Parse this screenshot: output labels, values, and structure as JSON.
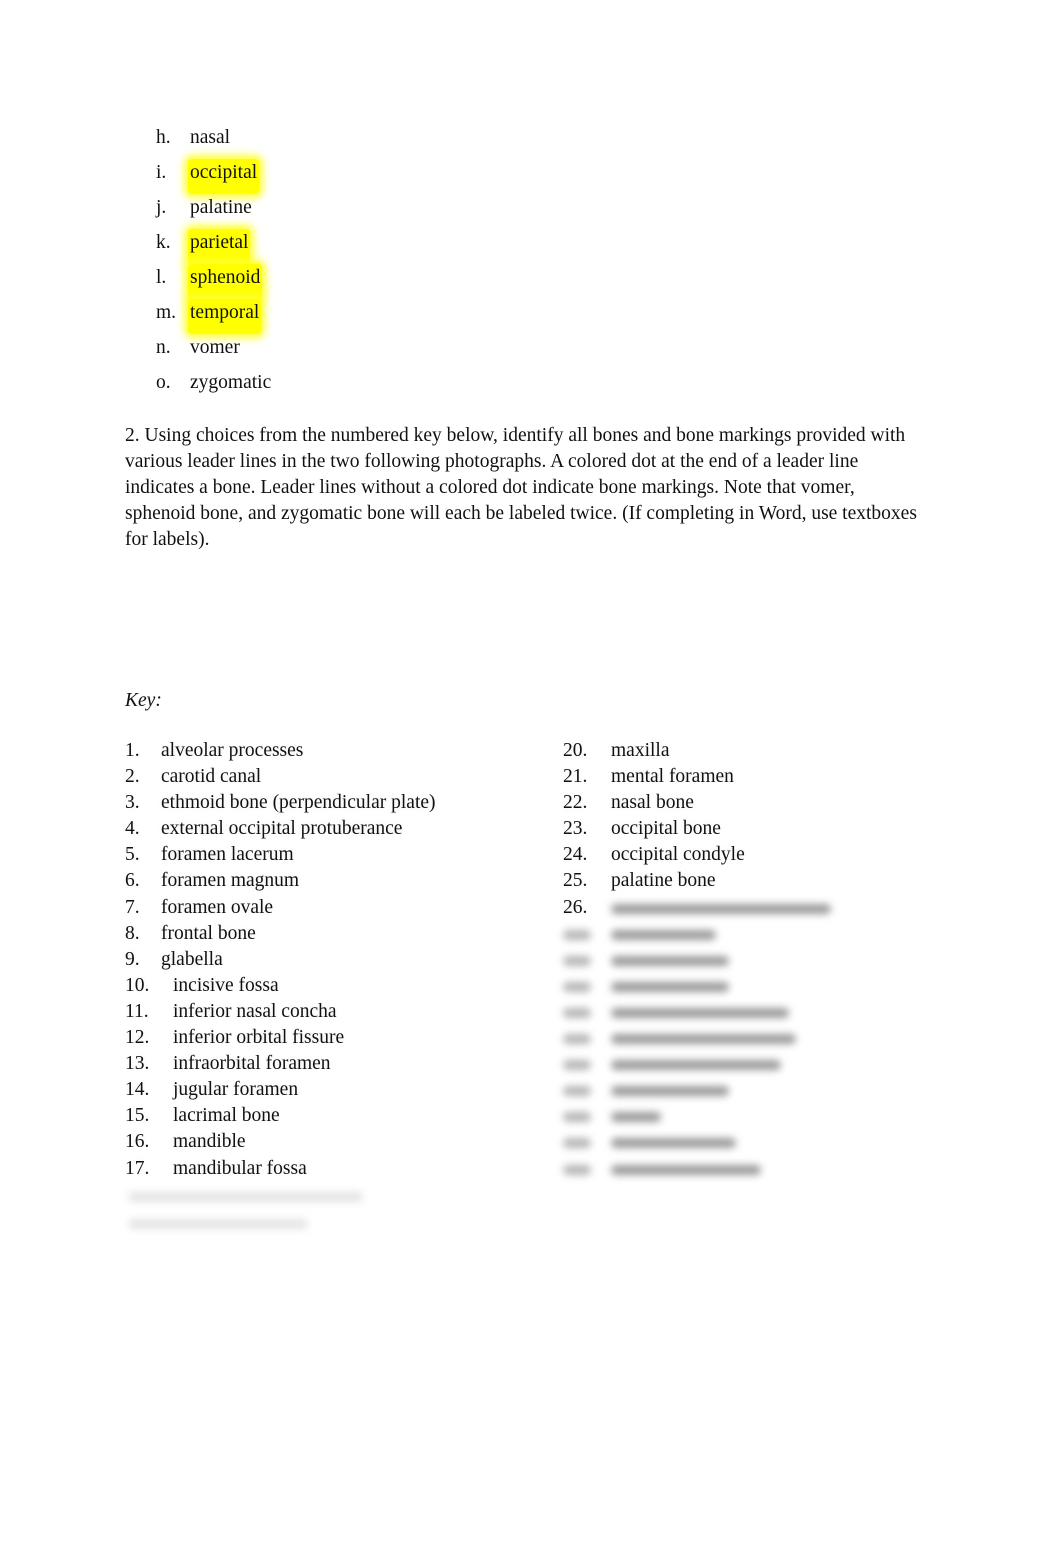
{
  "lettered_list": [
    {
      "marker": "h.",
      "text": "nasal",
      "highlighted": false
    },
    {
      "marker": "i.",
      "text": "occipital",
      "highlighted": true
    },
    {
      "marker": "j.",
      "text": "palatine",
      "highlighted": false
    },
    {
      "marker": "k.",
      "text": "parietal",
      "highlighted": true
    },
    {
      "marker": "l.",
      "text": "sphenoid",
      "highlighted": true
    },
    {
      "marker": "m.",
      "text": "temporal",
      "highlighted": true
    },
    {
      "marker": "n.",
      "text": "vomer",
      "highlighted": false
    },
    {
      "marker": "o.",
      "text": "zygomatic",
      "highlighted": false
    }
  ],
  "highlight_color": "#ffff00",
  "instructions": "2. Using choices from the numbered key below, identify all bones and bone markings provided with various leader lines in the two following photographs. A colored dot at the end of a leader line indicates a bone. Leader lines without a colored dot indicate bone markings. Note that vomer, sphenoid bone, and zygomatic bone will each be labeled twice. (If completing in Word, use textboxes for labels).",
  "key_label": "Key:",
  "key_left": [
    {
      "num": "1.",
      "text": "alveolar processes"
    },
    {
      "num": "2.",
      "text": "carotid canal"
    },
    {
      "num": "3.",
      "text": "ethmoid bone (perpendicular plate)"
    },
    {
      "num": "4.",
      "text": "external occipital protuberance"
    },
    {
      "num": "5.",
      "text": "foramen lacerum"
    },
    {
      "num": "6.",
      "text": "foramen magnum"
    },
    {
      "num": "7.",
      "text": "foramen ovale"
    },
    {
      "num": "8.",
      "text": "frontal bone"
    },
    {
      "num": "9.",
      "text": "glabella"
    },
    {
      "num": "10.",
      "text": "incisive fossa"
    },
    {
      "num": "11.",
      "text": "inferior nasal concha"
    },
    {
      "num": "12.",
      "text": "inferior orbital fissure"
    },
    {
      "num": "13.",
      "text": "infraorbital foramen"
    },
    {
      "num": "14.",
      "text": "jugular foramen"
    },
    {
      "num": "15.",
      "text": "lacrimal bone"
    },
    {
      "num": "16.",
      "text": "mandible"
    },
    {
      "num": "17.",
      "text": "mandibular fossa"
    }
  ],
  "key_right": [
    {
      "num": "20.",
      "text": "maxilla"
    },
    {
      "num": "21.",
      "text": "mental foramen"
    },
    {
      "num": "22.",
      "text": "nasal bone"
    },
    {
      "num": "23.",
      "text": "occipital bone"
    },
    {
      "num": "24.",
      "text": "occipital condyle"
    },
    {
      "num": "25.",
      "text": "palatine bone"
    },
    {
      "num": "26.",
      "text": ""
    }
  ],
  "blurred_right_count": 10
}
